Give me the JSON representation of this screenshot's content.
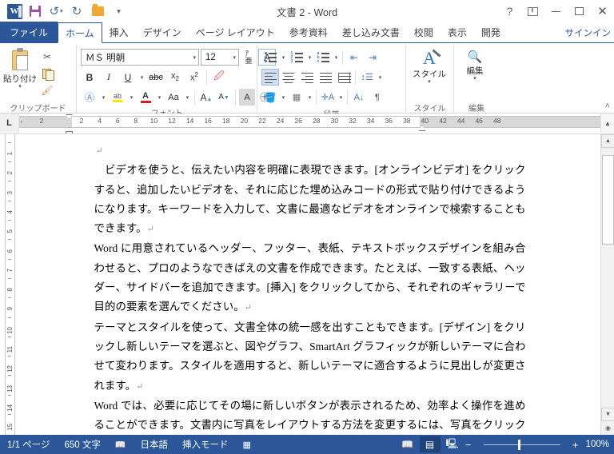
{
  "window": {
    "title": "文書 2 - Word",
    "quick_access": [
      {
        "name": "word-logo",
        "label": "W"
      },
      {
        "name": "save",
        "label": "保存"
      },
      {
        "name": "undo",
        "label": "元に戻す"
      },
      {
        "name": "redo",
        "label": "やり直し"
      },
      {
        "name": "open",
        "label": "開く"
      },
      {
        "name": "customize",
        "label": "クイック アクセス ツール バーのユーザー設定"
      }
    ],
    "controls": {
      "help": "?",
      "ribbon_display": "リボンの表示オプション",
      "minimize": "最小化",
      "maximize": "最大化",
      "close": "✕"
    }
  },
  "tabs": [
    {
      "label": "ファイル",
      "type": "file"
    },
    {
      "label": "ホーム",
      "type": "active"
    },
    {
      "label": "挿入",
      "type": "normal"
    },
    {
      "label": "デザイン",
      "type": "normal"
    },
    {
      "label": "ページ レイアウト",
      "type": "normal"
    },
    {
      "label": "参考資料",
      "type": "normal"
    },
    {
      "label": "差し込み文書",
      "type": "normal"
    },
    {
      "label": "校閲",
      "type": "normal"
    },
    {
      "label": "表示",
      "type": "normal"
    },
    {
      "label": "開発",
      "type": "normal"
    }
  ],
  "signin": "サインイン",
  "ribbon": {
    "collapse": "˄",
    "groups": {
      "clipboard": {
        "label": "クリップボード",
        "paste": "貼り付け",
        "cut": "切り取り",
        "copy": "コピー",
        "format_painter": "書式のコピー/貼り付け"
      },
      "font": {
        "label": "フォント",
        "font_name": "ＭＳ 明朝",
        "font_size": "12",
        "bold": "B",
        "italic": "I",
        "underline": "U",
        "strikethrough": "abc",
        "subscript": "x₂",
        "superscript": "x²",
        "clear_format": "すべての書式をクリア",
        "text_effects": "A",
        "highlight": "蛍光ペンの色",
        "font_color": "A",
        "change_case": "Aa",
        "grow_font": "A",
        "shrink_font": "A",
        "char_shading": "A",
        "enclose_char": "㋐",
        "phonetic": "ア亜"
      },
      "paragraph": {
        "label": "段落",
        "bullets": "箇条書き",
        "numbering": "段落番号",
        "multilevel": "アウトライン",
        "decrease_indent": "インデントを減らす",
        "increase_indent": "インデントを増やす",
        "align_left": "左揃え",
        "align_center": "中央揃え",
        "align_right": "右揃え",
        "justify": "両端揃え",
        "distribute": "均等割り付け",
        "line_spacing": "行と段落の間隔",
        "shading": "塗りつぶし",
        "borders": "罫線",
        "asian_layout": "拡張書式",
        "sort": "並べ替え",
        "show_marks": "編集記号の表示/非表示"
      },
      "styles": {
        "label": "スタイル",
        "button": "スタイル"
      },
      "editing": {
        "label": "編集",
        "button": "編集"
      }
    }
  },
  "ruler": {
    "tab_selector": "L",
    "horizontal_numbers": [
      2,
      2,
      4,
      6,
      8,
      10,
      12,
      14,
      16,
      18,
      20,
      22,
      24,
      26,
      28,
      30,
      32,
      34,
      36,
      38,
      40,
      42,
      44,
      46,
      48
    ],
    "vertical_numbers": [
      1,
      2,
      3,
      4,
      5,
      6,
      7,
      8,
      9,
      10,
      11,
      12,
      13,
      14,
      15
    ]
  },
  "document": {
    "paragraphs": [
      "",
      "　ビデオを使うと、伝えたい内容を明確に表現できます。[オンラインビデオ] をクリックすると、追加したいビデオを、それに応じた埋め込みコードの形式で貼り付けできるようになります。キーワードを入力して、文書に最適なビデオをオンラインで検索することもできます。",
      "Word に用意されているヘッダー、フッター、表紙、テキストボックスデザインを組み合わせると、プロのようなできばえの文書を作成できます。たとえば、一致する表紙、ヘッダー、サイドバーを追加できます。[挿入] をクリックしてから、それぞれのギャラリーで目的の要素を選んでください。",
      "テーマとスタイルを使って、文書全体の統一感を出すこともできます。[デザイン] をクリックし新しいテーマを選ぶと、図やグラフ、SmartArt グラフィックが新しいテーマに合わせて変わります。スタイルを適用すると、新しいテーマに適合するように見出しが変更されます。",
      "Word では、必要に応じてその場に新しいボタンが表示されるため、効率よく操作を進めることができます。文書内に写真をレイアウトする方法を変更するには、写真をクリックすると、隣にレイアウト オプションのボタンが表示されます。表で作業している場合は"
    ],
    "paragraph_mark": "↵"
  },
  "statusbar": {
    "page": "1/1 ページ",
    "words": "650 文字",
    "proofing_icon": "proofing-icon",
    "language": "日本語",
    "insert_mode": "挿入モード",
    "macro_icon": "macro-record-icon",
    "views": [
      {
        "name": "read-mode",
        "glyph": "📖",
        "active": false
      },
      {
        "name": "print-layout",
        "glyph": "▤",
        "active": true
      },
      {
        "name": "web-layout",
        "glyph": "🖳",
        "active": false
      }
    ],
    "zoom_out": "−",
    "zoom_in": "+",
    "zoom_level": "100%"
  },
  "colors": {
    "accent": "#2b579a",
    "ribbon_bg": "#ffffff",
    "status_bg": "#2b579a"
  }
}
